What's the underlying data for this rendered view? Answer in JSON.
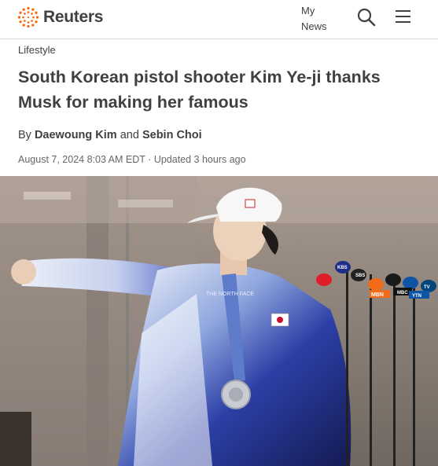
{
  "header": {
    "brand": "Reuters",
    "my_news": "My News",
    "brand_color": "#fa6400"
  },
  "article": {
    "category": "Lifestyle",
    "headline": "South Korean pistol shooter Kim Ye-ji thanks Musk for making her famous",
    "byline_prefix": "By",
    "author_1": "Daewoung Kim",
    "byline_and": "and",
    "author_2": "Sebin Choi",
    "published": "August 7, 2024 8:03 AM EDT",
    "separator": "·",
    "updated": "Updated 3 hours ago"
  },
  "photo": {
    "subject": "pistol shooter in white cap and blue-white jacket with silver medal",
    "microphone_labels": [
      "KBS",
      "MBN",
      "SBS",
      "MBC",
      "YTN",
      "TV"
    ]
  }
}
